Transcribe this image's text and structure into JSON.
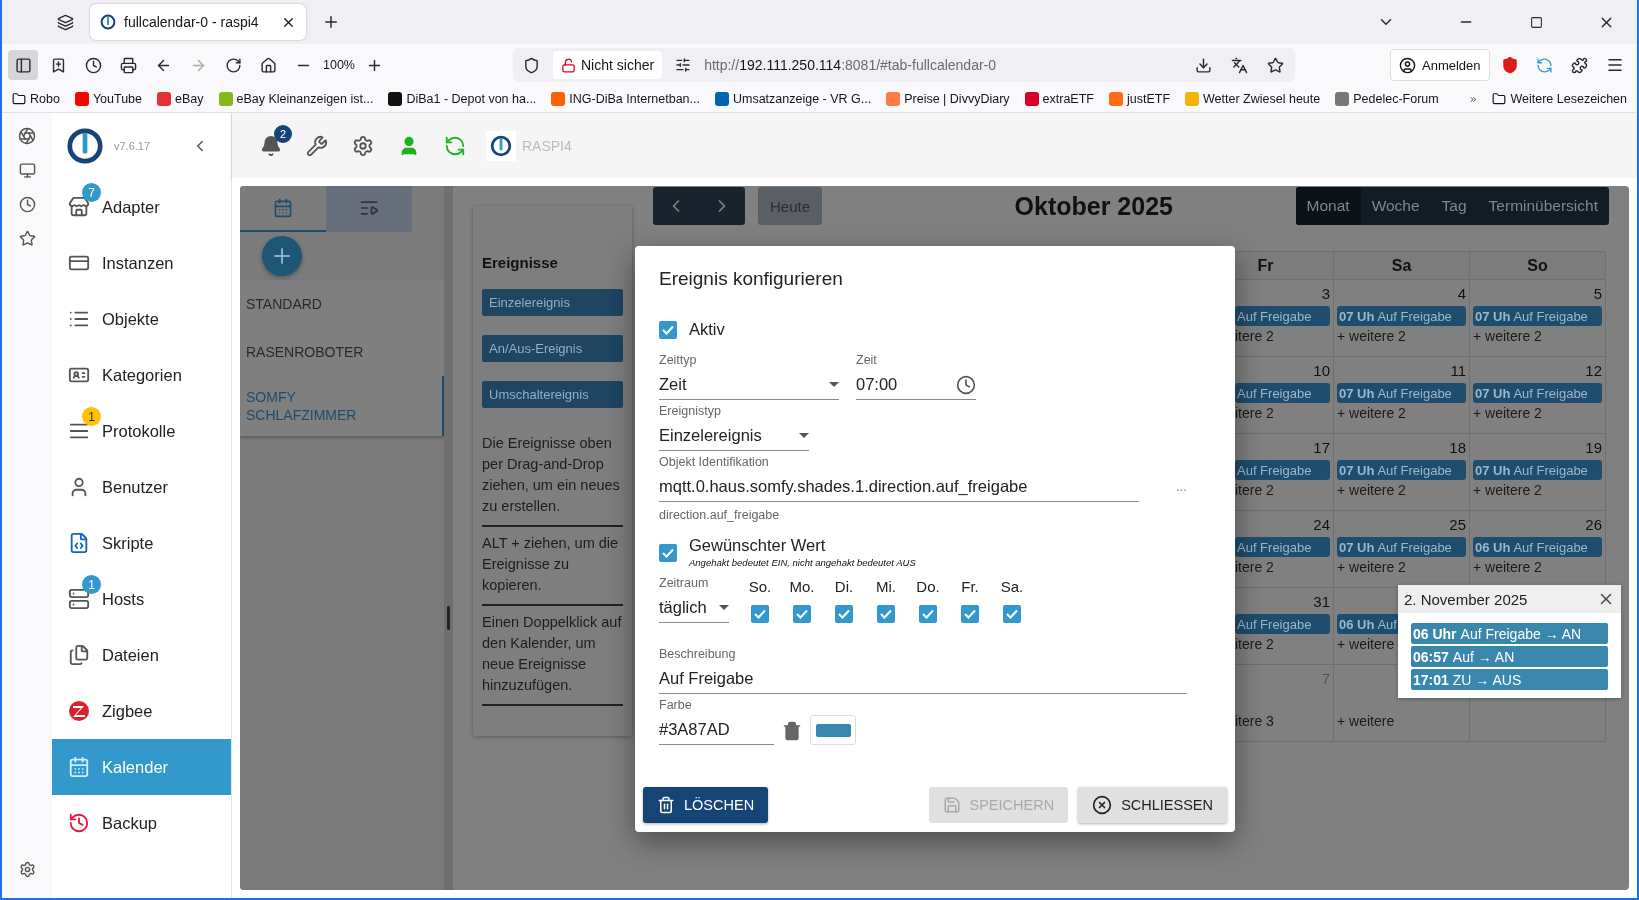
{
  "browser": {
    "tab_title": "fullcalendar-0 - raspi4",
    "zoom": "100%",
    "security": "Nicht sicher",
    "url": {
      "scheme": "http://",
      "host": "192.111.250.114",
      "rest": ":8081/#tab-fullcalendar-0"
    },
    "profile": "Anmelden",
    "bookmarks": [
      {
        "label": "Robo",
        "kind": "folder"
      },
      {
        "label": "YouTube",
        "kind": "site",
        "color": "#ff0000"
      },
      {
        "label": "eBay",
        "kind": "site",
        "color": "#e53238"
      },
      {
        "label": "eBay Kleinanzeigen ist...",
        "kind": "site",
        "color": "#86b817"
      },
      {
        "label": "DiBa1 - Depot von ha...",
        "kind": "site",
        "color": "#111111"
      },
      {
        "label": "ING-DiBa Internetban...",
        "kind": "site",
        "color": "#ff6200"
      },
      {
        "label": "Umsatzanzeige - VR G...",
        "kind": "site",
        "color": "#0066b3"
      },
      {
        "label": "Preise | DivvyDiary",
        "kind": "site",
        "color": "#ff7a45"
      },
      {
        "label": "extraETF",
        "kind": "site",
        "color": "#d6002a"
      },
      {
        "label": "justETF",
        "kind": "site",
        "color": "#ff6a13"
      },
      {
        "label": "Wetter Zwiesel heute",
        "kind": "site",
        "color": "#f2b705"
      },
      {
        "label": "Pedelec-Forum",
        "kind": "site",
        "color": "#777777"
      }
    ],
    "more_bookmarks": "Weitere Lesezeichen"
  },
  "app": {
    "version": "v7.6.17",
    "notifications": "2",
    "host": "RASPI4",
    "nav": [
      {
        "label": "Adapter",
        "badge": "7",
        "color": "#3399cc",
        "selected": false
      },
      {
        "label": "Instanzen",
        "selected": false
      },
      {
        "label": "Objekte",
        "selected": false
      },
      {
        "label": "Kategorien",
        "selected": false
      },
      {
        "label": "Protokolle",
        "badge": "1",
        "color": "#ffc107",
        "selected": false
      },
      {
        "label": "Benutzer",
        "selected": false
      },
      {
        "label": "Skripte",
        "selected": false
      },
      {
        "label": "Hosts",
        "badge": "1",
        "color": "#3399cc",
        "selected": false
      },
      {
        "label": "Dateien",
        "selected": false
      },
      {
        "label": "Zigbee",
        "selected": false
      },
      {
        "label": "Kalender",
        "selected": true
      },
      {
        "label": "Backup",
        "selected": false
      }
    ]
  },
  "left_panel": {
    "tabs": [
      {
        "kind": "calendar",
        "selected": true
      },
      {
        "kind": "list",
        "selected": false
      }
    ],
    "categories": [
      {
        "label": "STANDARD",
        "selected": false
      },
      {
        "label": "RASENROBOTER",
        "selected": false
      },
      {
        "label": "SOMFY SCHLAFZIMMER",
        "selected": true
      }
    ]
  },
  "events_panel": {
    "title": "Ereignisse",
    "buttons": [
      "Einzelereignis",
      "An/Aus-Ereignis",
      "Umschaltereignis"
    ],
    "hints": [
      "Die Ereignisse oben per Drag-and-Drop ziehen, um ein neues zu erstellen.",
      "ALT + ziehen, um die Ereignisse zu kopieren.",
      "Einen Doppelklick auf den Kalender, um neue Ereignisse hinzuzufügen."
    ]
  },
  "calendar": {
    "today": "Heute",
    "title": "Oktober 2025",
    "views": [
      {
        "label": "Monat",
        "selected": true
      },
      {
        "label": "Woche",
        "selected": false
      },
      {
        "label": "Tag",
        "selected": false
      },
      {
        "label": "Terminübersicht",
        "selected": false
      }
    ],
    "weekdays": [
      "Fr",
      "Sa",
      "So"
    ],
    "weeks": [
      {
        "cells": [
          {
            "kind": "partial",
            "day": "3",
            "events": [
              {
                "title": "Auf Freigabe"
              }
            ],
            "more": "itere 2"
          },
          {
            "kind": "full",
            "day": "4",
            "events": [
              {
                "time": "07 Uh",
                "title": "Auf Freigabe"
              }
            ],
            "more": "+ weitere 2"
          },
          {
            "kind": "full",
            "day": "5",
            "events": [
              {
                "time": "07 Uh",
                "title": "Auf Freigabe"
              }
            ],
            "more": "+ weitere 2"
          }
        ]
      },
      {
        "cells": [
          {
            "kind": "partial",
            "day": "10",
            "events": [
              {
                "title": "Auf Freigabe"
              }
            ],
            "more": "itere 2"
          },
          {
            "kind": "full",
            "day": "11",
            "events": [
              {
                "time": "07 Uh",
                "title": "Auf Freigabe"
              }
            ],
            "more": "+ weitere 2"
          },
          {
            "kind": "full",
            "day": "12",
            "events": [
              {
                "time": "07 Uh",
                "title": "Auf Freigabe"
              }
            ],
            "more": "+ weitere 2"
          }
        ]
      },
      {
        "cells": [
          {
            "kind": "partial",
            "day": "17",
            "events": [
              {
                "title": "Auf Freigabe"
              }
            ],
            "more": "itere 2"
          },
          {
            "kind": "full",
            "day": "18",
            "events": [
              {
                "time": "07 Uh",
                "title": "Auf Freigabe"
              }
            ],
            "more": "+ weitere 2"
          },
          {
            "kind": "full",
            "day": "19",
            "events": [
              {
                "time": "07 Uh",
                "title": "Auf Freigabe"
              }
            ],
            "more": "+ weitere 2"
          }
        ]
      },
      {
        "cells": [
          {
            "kind": "partial",
            "day": "24",
            "events": [
              {
                "title": "Auf Freigabe"
              }
            ],
            "more": "itere 2"
          },
          {
            "kind": "full",
            "day": "25",
            "events": [
              {
                "time": "07 Uh",
                "title": "Auf Freigabe"
              }
            ],
            "more": "+ weitere 2"
          },
          {
            "kind": "full",
            "day": "26",
            "events": [
              {
                "time": "06 Uh",
                "title": "Auf Freigabe"
              }
            ],
            "more": "+ weitere 2"
          }
        ]
      },
      {
        "cells": [
          {
            "kind": "partial",
            "day": "31",
            "events": [
              {
                "title": "Auf Freigabe"
              }
            ],
            "more": "itere 2"
          },
          {
            "kind": "full",
            "events": [
              {
                "time": "06 Uh",
                "title": "Auf"
              }
            ],
            "more": "+ weitere"
          },
          {
            "kind": "covered"
          }
        ]
      },
      {
        "cells": [
          {
            "kind": "partial",
            "day": "7",
            "other_month": true,
            "more": "itere 3"
          },
          {
            "kind": "full",
            "more": "+ weitere"
          },
          {
            "kind": "full"
          }
        ]
      }
    ]
  },
  "dialog": {
    "title": "Ereignis konfigurieren",
    "active": {
      "label": "Aktiv",
      "checked": true
    },
    "time_type": {
      "label": "Zeittyp",
      "value": "Zeit"
    },
    "time": {
      "label": "Zeit",
      "value": "07:00"
    },
    "event_type": {
      "label": "Ereignistyp",
      "value": "Einzelereignis"
    },
    "object_id": {
      "label": "Objekt Identifikation",
      "value": "mqtt.0.haus.somfy.shades.1.direction.auf_freigabe",
      "more": "...",
      "helper": "direction.auf_freigabe"
    },
    "desired_value": {
      "label": "Gewünschter Wert",
      "hint": "Angehakt bedeutet EIN, nicht angehakt bedeutet AUS",
      "checked": true
    },
    "period": {
      "label": "Zeitraum",
      "value": "täglich"
    },
    "days": [
      {
        "label": "So.",
        "checked": true
      },
      {
        "label": "Mo.",
        "checked": true
      },
      {
        "label": "Di.",
        "checked": true
      },
      {
        "label": "Mi.",
        "checked": true
      },
      {
        "label": "Do.",
        "checked": true
      },
      {
        "label": "Fr.",
        "checked": true
      },
      {
        "label": "Sa.",
        "checked": true
      }
    ],
    "description": {
      "label": "Beschreibung",
      "value": "Auf Freigabe"
    },
    "color": {
      "label": "Farbe",
      "value": "#3A87AD",
      "color": "#3a87ad"
    },
    "buttons": [
      {
        "label": "LÖSCHEN",
        "kind": "delete",
        "disabled": false
      },
      {
        "label": "SPEICHERN",
        "kind": "save",
        "disabled": true
      },
      {
        "label": "SCHLIESSEN",
        "kind": "close",
        "disabled": false
      }
    ]
  },
  "popover": {
    "title": "2. November 2025",
    "events": [
      {
        "time": "06 Uhr",
        "title": "Auf Freigabe → AN"
      },
      {
        "time": "06:57",
        "title": "Auf → AN"
      },
      {
        "time": "17:01",
        "title": "ZU → AUS"
      }
    ]
  }
}
